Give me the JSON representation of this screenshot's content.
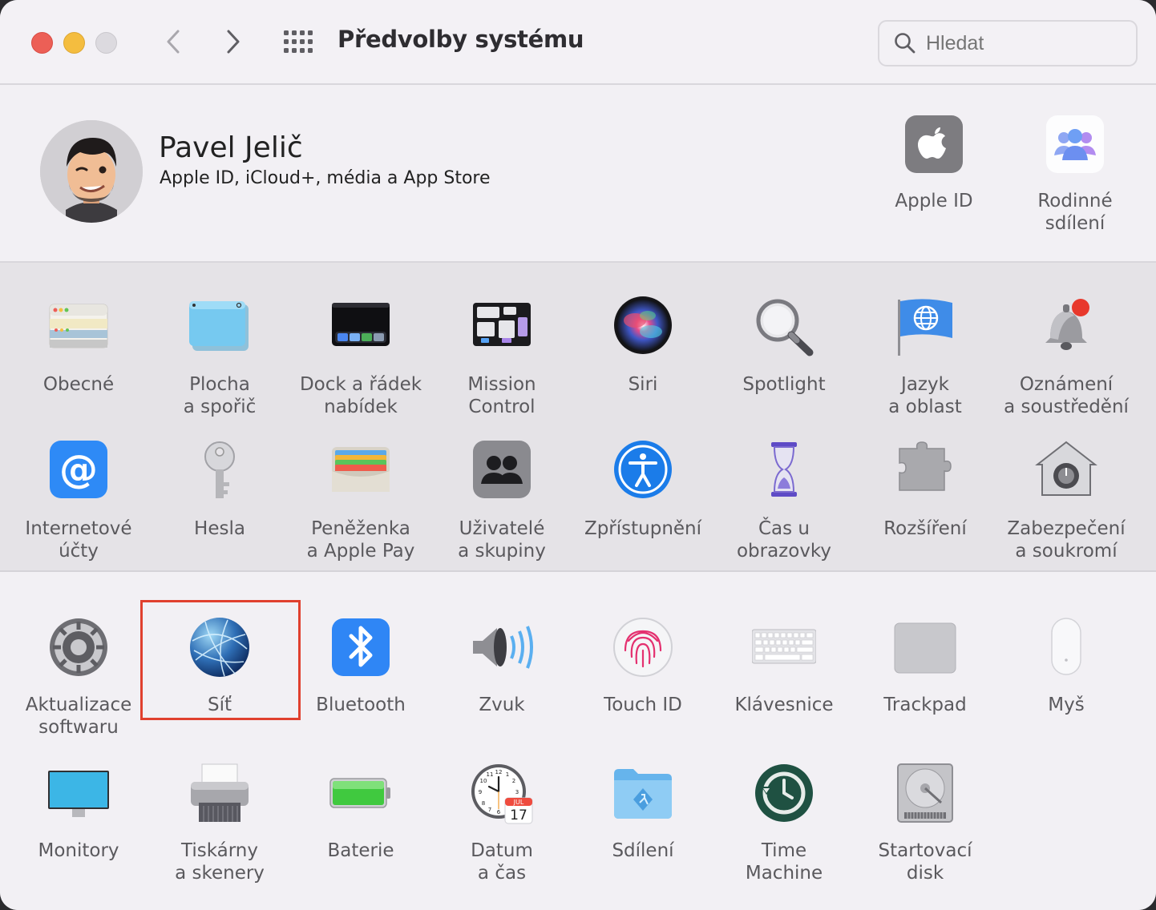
{
  "window": {
    "title": "Předvolby systému"
  },
  "search": {
    "placeholder": "Hledat"
  },
  "account": {
    "name": "Pavel Jelič",
    "subtitle": "Apple ID, iCloud+, média a App Store",
    "items": [
      {
        "label": "Apple ID",
        "icon": "apple-id-icon"
      },
      {
        "label": "Rodinné\nsdílení",
        "icon": "family-sharing-icon"
      }
    ]
  },
  "section1": [
    {
      "label": "Obecné",
      "icon": "general-icon"
    },
    {
      "label": "Plocha\na spořič",
      "icon": "desktop-icon"
    },
    {
      "label": "Dock a řádek\nnabídek",
      "icon": "dock-icon"
    },
    {
      "label": "Mission\nControl",
      "icon": "mission-control-icon"
    },
    {
      "label": "Siri",
      "icon": "siri-icon"
    },
    {
      "label": "Spotlight",
      "icon": "spotlight-icon"
    },
    {
      "label": "Jazyk\na oblast",
      "icon": "language-icon"
    },
    {
      "label": "Oznámení\na soustředění",
      "icon": "notifications-icon"
    },
    {
      "label": "Internetové\núčty",
      "icon": "internet-accounts-icon"
    },
    {
      "label": "Hesla",
      "icon": "passwords-icon"
    },
    {
      "label": "Peněženka\na Apple Pay",
      "icon": "wallet-icon"
    },
    {
      "label": "Uživatelé\na skupiny",
      "icon": "users-icon"
    },
    {
      "label": "Zpřístupnění",
      "icon": "accessibility-icon"
    },
    {
      "label": "Čas u obrazovky",
      "icon": "screen-time-icon"
    },
    {
      "label": "Rozšíření",
      "icon": "extensions-icon"
    },
    {
      "label": "Zabezpečení\na soukromí",
      "icon": "security-icon"
    }
  ],
  "section2": [
    {
      "label": "Aktualizace\nsoftwaru",
      "icon": "software-update-icon"
    },
    {
      "label": "Síť",
      "icon": "network-icon"
    },
    {
      "label": "Bluetooth",
      "icon": "bluetooth-icon"
    },
    {
      "label": "Zvuk",
      "icon": "sound-icon"
    },
    {
      "label": "Touch ID",
      "icon": "touch-id-icon"
    },
    {
      "label": "Klávesnice",
      "icon": "keyboard-icon"
    },
    {
      "label": "Trackpad",
      "icon": "trackpad-icon"
    },
    {
      "label": "Myš",
      "icon": "mouse-icon"
    },
    {
      "label": "Monitory",
      "icon": "displays-icon"
    },
    {
      "label": "Tiskárny\na skenery",
      "icon": "printers-icon"
    },
    {
      "label": "Baterie",
      "icon": "battery-icon"
    },
    {
      "label": "Datum\na čas",
      "icon": "date-time-icon"
    },
    {
      "label": "Sdílení",
      "icon": "sharing-icon"
    },
    {
      "label": "Time\nMachine",
      "icon": "time-machine-icon"
    },
    {
      "label": "Startovací\ndisk",
      "icon": "startup-disk-icon"
    }
  ],
  "clock": {
    "month": "JUL",
    "day": "17"
  },
  "highlight": {
    "target": "Síť",
    "color": "#e0402e"
  }
}
